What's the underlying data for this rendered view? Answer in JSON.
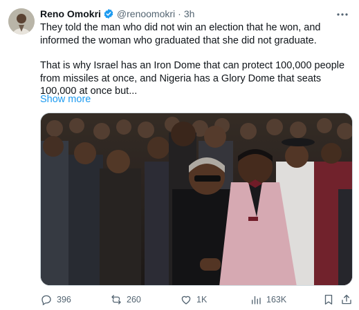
{
  "author": {
    "name": "Reno Omokri",
    "handle": "@renoomokri",
    "separator": "·",
    "time": "3h"
  },
  "tweet": {
    "paragraph1": "They told the man who did not win an election that he won, and informed the woman who graduated that she did not graduate.",
    "paragraph2": "That is why Israel has an Iron Dome that can protect 100,000 people from missiles at once, and Nigeria has a Glory Dome that seats 100,000 at once but...",
    "show_more": "Show more"
  },
  "actions": {
    "replies": "396",
    "reposts": "260",
    "likes": "1K",
    "views": "163K"
  },
  "icons": [
    "verified-badge-icon",
    "more-options-icon",
    "reply-icon",
    "repost-icon",
    "like-icon",
    "views-icon",
    "bookmark-icon",
    "share-icon"
  ],
  "colors": {
    "accent": "#1d9bf0",
    "muted": "#536471",
    "text": "#0f1419"
  }
}
